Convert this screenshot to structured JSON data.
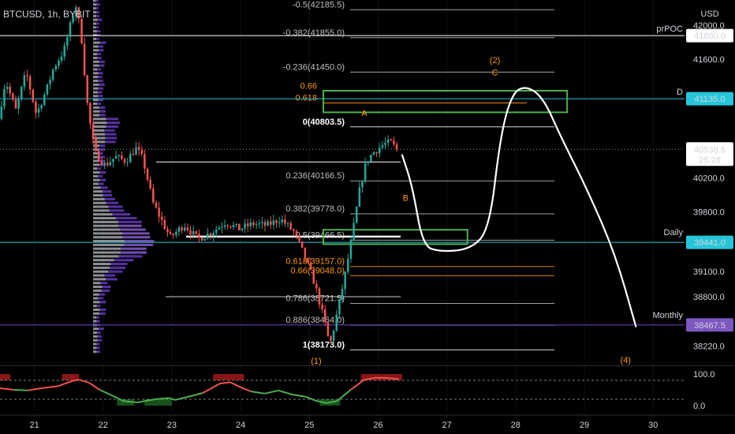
{
  "header": {
    "symbol_line": "BTCUSD, 1h, BYBIT",
    "currency": "USD"
  },
  "chart_data": {
    "type": "candlestick",
    "symbol": "BTCUSD",
    "timeframe": "1h",
    "exchange": "BYBIT",
    "ylim": [
      38000,
      42300
    ],
    "xlim": [
      20.5,
      30.4
    ],
    "y_ticks": [
      "42000.0",
      "41600.0",
      "40200.0",
      "39800.0",
      "39100.0",
      "38800.0",
      "38220.0"
    ],
    "x_ticks": [
      {
        "label": "21",
        "x": 21
      },
      {
        "label": "22",
        "x": 22
      },
      {
        "label": "23",
        "x": 23
      },
      {
        "label": "24",
        "x": 24
      },
      {
        "label": "25",
        "x": 25
      },
      {
        "label": "26",
        "x": 26
      },
      {
        "label": "27",
        "x": 27
      },
      {
        "label": "28",
        "x": 28
      },
      {
        "label": "29",
        "x": 29
      },
      {
        "label": "30",
        "x": 30
      }
    ],
    "price_labels": [
      {
        "name": "prPOC",
        "text": "41880.0",
        "price": 41880,
        "color": "#ffffff",
        "text_color": "#000000"
      },
      {
        "name": "D",
        "text": "41135.0",
        "price": 41135,
        "color": "#26c6da",
        "text_color": "#000000"
      },
      {
        "name": "",
        "text": "40538.5",
        "sub": "25:28",
        "price": 40538.5,
        "color": "#ffffff",
        "text_color": "#000000"
      },
      {
        "name": "Daily",
        "text": "39441.0",
        "price": 39441,
        "color": "#26c6da",
        "text_color": "#000000"
      },
      {
        "name": "Monthly",
        "text": "38467.5",
        "price": 38467.5,
        "color": "#7e57c2",
        "text_color": "#ffffff"
      }
    ],
    "fib_levels": [
      {
        "label": "-0.5(42185.5)",
        "price": 42185.5,
        "color": "#bfbfbf"
      },
      {
        "label": "-0.382(41855.0)",
        "price": 41855,
        "color": "#bfbfbf"
      },
      {
        "label": "-0.236(41450.0)",
        "price": 41450,
        "color": "#bfbfbf"
      },
      {
        "label": "0.66",
        "price": 41225,
        "color": "#ff9800"
      },
      {
        "label": "0.618",
        "price": 41085,
        "color": "#ff9800"
      },
      {
        "label": "0(40803.5)",
        "price": 40803.5,
        "color": "#ffffff"
      },
      {
        "label": "0.236(40166.5)",
        "price": 40166.5,
        "color": "#bfbfbf"
      },
      {
        "label": "0.382(39778.0)",
        "price": 39778,
        "color": "#bfbfbf"
      },
      {
        "label": "0.5(39466.5)",
        "price": 39466.5,
        "color": "#bfbfbf"
      },
      {
        "label": "0.618(39157.0)",
        "price": 39157,
        "color": "#ff9800"
      },
      {
        "label": "0.66(39048.0)",
        "price": 39048,
        "color": "#ff9800"
      },
      {
        "label": "0.786(38721.5)",
        "price": 38721.5,
        "color": "#bfbfbf"
      },
      {
        "label": "0.886(38464.0)",
        "price": 38464,
        "color": "#bfbfbf"
      },
      {
        "label": "1(38173.0)",
        "price": 38173,
        "color": "#ffffff"
      }
    ],
    "wave_labels": [
      {
        "text": "(2)",
        "x": 27.7,
        "price": 41555
      },
      {
        "text": "C",
        "x": 27.7,
        "price": 41410
      },
      {
        "text": "A",
        "x": 25.8,
        "price": 40930
      },
      {
        "text": "B",
        "x": 26.4,
        "price": 39930
      },
      {
        "text": "(4)",
        "x": 29.6,
        "price": 38020
      },
      {
        "text": "(1)",
        "x": 25.1,
        "price": 38010
      }
    ],
    "zones": [
      {
        "x0": 25.05,
        "x1": 28.75,
        "p0": 41230,
        "p1": 40975,
        "color": "#4caf50"
      },
      {
        "x0": 25.05,
        "x1": 27.3,
        "p0": 39590,
        "p1": 39420,
        "color": "#4caf50"
      }
    ],
    "projection": [
      [
        26.35,
        40470
      ],
      [
        26.5,
        40100
      ],
      [
        26.65,
        39400
      ],
      [
        26.9,
        39330
      ],
      [
        27.35,
        39360
      ],
      [
        27.62,
        39600
      ],
      [
        27.78,
        40700
      ],
      [
        27.95,
        41200
      ],
      [
        28.15,
        41290
      ],
      [
        28.4,
        41150
      ],
      [
        28.65,
        40700
      ],
      [
        29.05,
        40050
      ],
      [
        29.45,
        39300
      ],
      [
        29.75,
        38450
      ]
    ],
    "close_price": 40538.5,
    "candles": [],
    "oscillator": {
      "ylim": [
        -20,
        120
      ],
      "ticks": [
        "100.0",
        "0.0"
      ],
      "levels": [
        80,
        20
      ],
      "values": [
        [
          20.5,
          55
        ],
        [
          20.7,
          50
        ],
        [
          20.9,
          48
        ],
        [
          21.1,
          55
        ],
        [
          21.35,
          62
        ],
        [
          21.55,
          78
        ],
        [
          21.65,
          82
        ],
        [
          21.8,
          72
        ],
        [
          21.95,
          50
        ],
        [
          22.1,
          35
        ],
        [
          22.3,
          14
        ],
        [
          22.5,
          10
        ],
        [
          22.75,
          20
        ],
        [
          22.95,
          24
        ],
        [
          23.05,
          18
        ],
        [
          23.2,
          26
        ],
        [
          23.45,
          40
        ],
        [
          23.7,
          70
        ],
        [
          23.85,
          74
        ],
        [
          24.0,
          58
        ],
        [
          24.15,
          45
        ],
        [
          24.35,
          38
        ],
        [
          24.55,
          48
        ],
        [
          24.75,
          35
        ],
        [
          24.95,
          28
        ],
        [
          25.1,
          15
        ],
        [
          25.25,
          8
        ],
        [
          25.4,
          14
        ],
        [
          25.6,
          50
        ],
        [
          25.8,
          82
        ],
        [
          25.95,
          88
        ],
        [
          26.1,
          88
        ],
        [
          26.3,
          84
        ]
      ],
      "overbought_zones": [
        [
          20.5,
          20.65
        ],
        [
          21.4,
          21.65
        ],
        [
          23.6,
          24.05
        ],
        [
          25.75,
          26.35
        ]
      ],
      "oversold_zones": [
        [
          22.2,
          22.45
        ],
        [
          22.6,
          23.0
        ],
        [
          25.15,
          25.45
        ]
      ]
    }
  },
  "colors": {
    "bull": "#26a69a",
    "bear": "#ef5350",
    "grid": "#2a2e39",
    "text": "#d1d4dc",
    "profile_grey": "#b2b5be",
    "profile_purple": "#5e35b1",
    "profile_purple_light": "#7e57c2"
  }
}
